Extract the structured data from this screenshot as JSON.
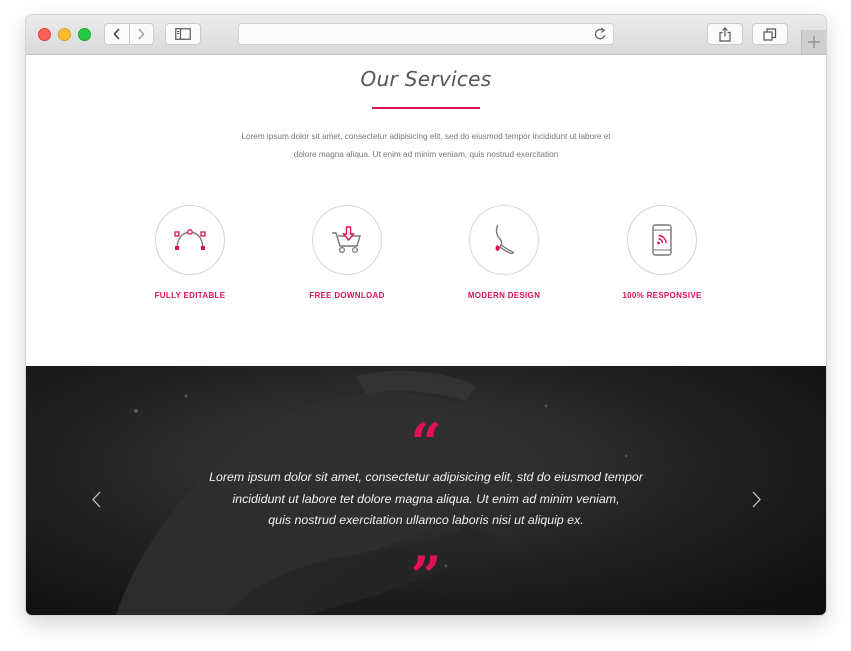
{
  "browser": {
    "url": "",
    "icons": {
      "back": "chevron-left-icon",
      "forward": "chevron-right-icon",
      "sidebar": "sidebar-icon",
      "reload": "reload-icon",
      "share": "share-icon",
      "tabs": "tabs-icon",
      "new_tab": "plus-icon"
    }
  },
  "services": {
    "title": "Our Services",
    "intro_line1": "Lorem ipsum dolor sit amet, consectetur adipisicing elit, sed do eiusmod tempor incididunt ut labore et",
    "intro_line2": "dolore magna aliqua. Ut enim ad minim veniam, quis nostrud exercitation",
    "items": [
      {
        "label": "FULLY EDITABLE",
        "icon": "bezier-curve-icon"
      },
      {
        "label": "FREE DOWNLOAD",
        "icon": "cart-download-icon"
      },
      {
        "label": "MODERN DESIGN",
        "icon": "paintbrush-icon"
      },
      {
        "label": "100% RESPONSIVE",
        "icon": "mobile-phone-icon"
      }
    ]
  },
  "testimonial": {
    "open_quote": "“",
    "close_quote": "”",
    "line1": "Lorem ipsum dolor sit amet, consectetur adipisicing elit, std do eiusmod tempor",
    "line2": "incididunt ut labore tet dolore magna aliqua.  Ut enim ad minim veniam,",
    "line3": "quis nostrud exercitation ullamco laboris nisi ut aliquip ex."
  },
  "colors": {
    "accent": "#e0105a",
    "heading": "#555555",
    "body_text": "#777777",
    "dark_bg": "#1c1c1c"
  }
}
